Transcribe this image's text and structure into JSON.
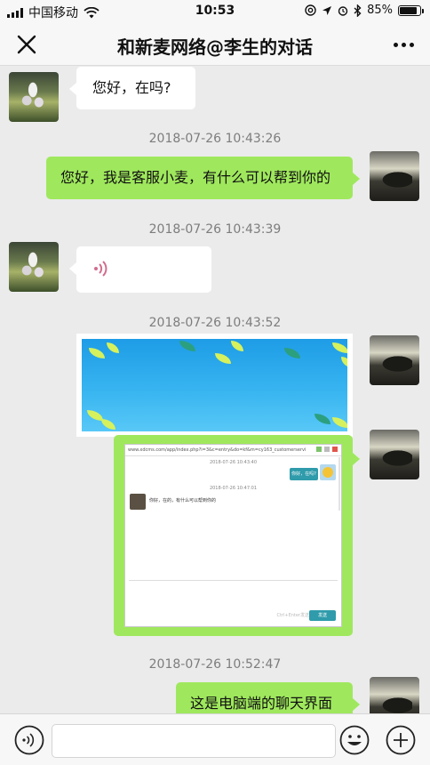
{
  "status_bar": {
    "carrier": "中国移动",
    "time": "10:53",
    "battery": "85%",
    "battery_level": 0.85
  },
  "nav": {
    "title": "和新麦网络@李生的对话"
  },
  "messages": {
    "m1_text": "您好，在吗?",
    "ts1": "2018-07-26 10:43:26",
    "m2_text": "您好，我是客服小麦，有什么可以帮到你的",
    "ts2": "2018-07-26 10:43:39",
    "ts3": "2018-07-26 10:43:52",
    "ts4": "2018-07-26 10:52:47",
    "m5_text": "这是电脑端的聊天界面"
  },
  "screenshot": {
    "url": "www.xdcms.com/app/index.php?i=3&c=entry&do=kf&m=cy163_customerservice",
    "ts_a": "2018-07-26 10:43:40",
    "msg_right": "你好，在吗?",
    "ts_b": "2018-07-26 10:47:01",
    "msg_left": "你好，在的，有什么可以帮到你的",
    "hint": "Ctrl+Enter发送",
    "send": "发送"
  },
  "toolbar": {
    "input_value": ""
  },
  "colors": {
    "accent_green": "#9fe85d",
    "background": "#ebebeb"
  }
}
